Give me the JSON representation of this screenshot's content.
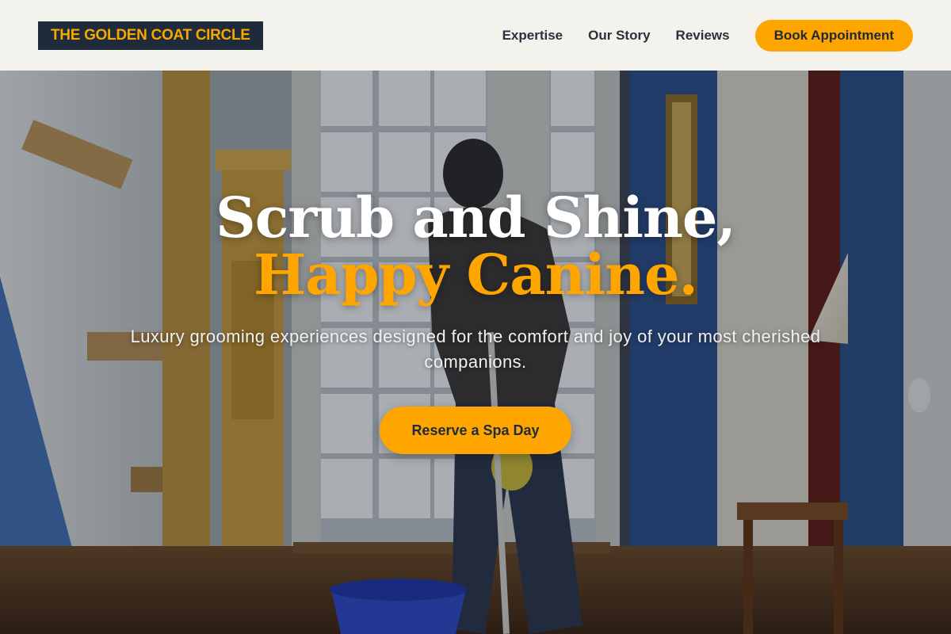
{
  "brand": {
    "name": "THE GOLDEN COAT CIRCLE"
  },
  "nav": {
    "links": [
      "Expertise",
      "Our Story",
      "Reviews"
    ],
    "cta_label": "Book Appointment"
  },
  "hero": {
    "title_line1": "Scrub and Shine,",
    "title_line2": "Happy Canine.",
    "subtitle": "Luxury grooming experiences designed for the comfort and joy of your most cherished companions.",
    "button_label": "Reserve a Spa Day",
    "background_image": "man-mopping-hallway-photo"
  },
  "colors": {
    "accent": "#ffa500",
    "navy": "#1f2a3b",
    "header_bg": "#f3f2ec"
  }
}
